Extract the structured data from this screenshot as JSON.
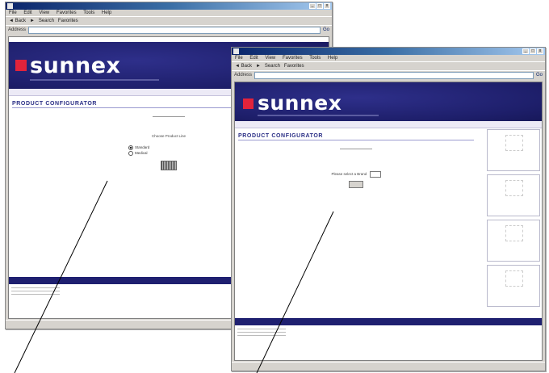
{
  "browser": {
    "menu_items": [
      "File",
      "Edit",
      "View",
      "Favorites",
      "Tools",
      "Help"
    ],
    "toolbar": {
      "back": "Back",
      "search": "Search",
      "favorites": "Favorites"
    },
    "address_label": "Address",
    "go_label": "Go"
  },
  "site": {
    "logo": "sunnex",
    "page_title": "PRODUCT CONFIGURATOR"
  },
  "window1": {
    "choose_label": "Choose Product Line",
    "radio_options": [
      "Standard",
      "Medical"
    ]
  },
  "window2": {
    "select_label": "Please select a Brand"
  },
  "colors": {
    "banner": "#1e1f6b",
    "logo_red": "#e2233b",
    "title_blue": "#2b2f86"
  }
}
